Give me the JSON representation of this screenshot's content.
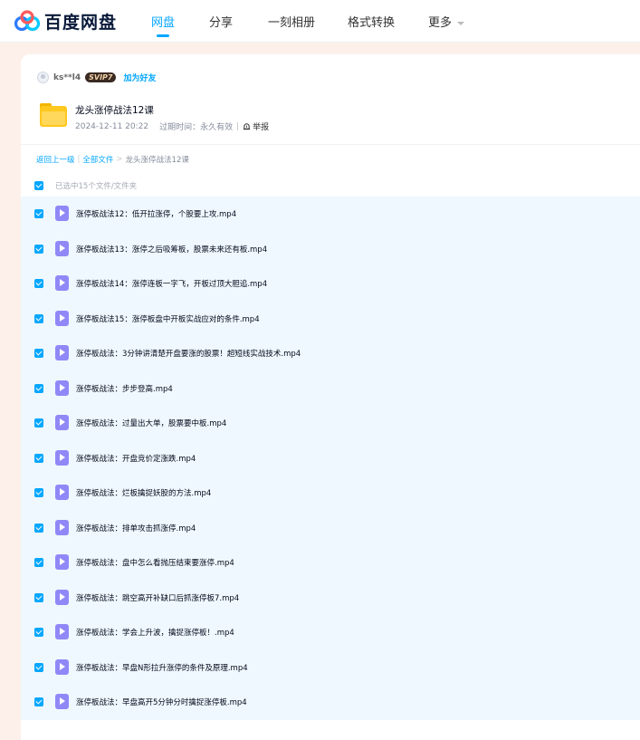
{
  "brand": {
    "name": "百度网盘"
  },
  "nav": {
    "items": [
      {
        "label": "网盘"
      },
      {
        "label": "分享"
      },
      {
        "label": "一刻相册"
      },
      {
        "label": "格式转换"
      },
      {
        "label": "更多"
      }
    ]
  },
  "sharer": {
    "name": "ks**l4",
    "vip": "SVIP7",
    "add_friend": "加为好友"
  },
  "share": {
    "title": "龙头涨停战法12课",
    "date": "2024-12-11 20:22",
    "expiry": "过期时间：永久有效",
    "report": "举报"
  },
  "breadcrumb": {
    "back": "返回上一级",
    "all": "全部文件",
    "current": "龙头涨停战法12课"
  },
  "selection": {
    "text": "已选中15个文件/文件夹"
  },
  "files": [
    {
      "name": "涨停板战法12：低开拉涨停，个股要上攻.mp4"
    },
    {
      "name": "涨停板战法13：涨停之后吸筹板，股票未来还有板.mp4"
    },
    {
      "name": "涨停板战法14：涨停连板一字飞，开板过顶大胆追.mp4"
    },
    {
      "name": "涨停板战法15：涨停板盘中开板实战应对的条件.mp4"
    },
    {
      "name": "涨停板战法：3分钟讲清楚开盘要涨的股票！超短线实战技术.mp4"
    },
    {
      "name": "涨停板战法：步步登高.mp4"
    },
    {
      "name": "涨停板战法：过量出大单，股票要中板.mp4"
    },
    {
      "name": "涨停板战法：开盘竞价定涨跌.mp4"
    },
    {
      "name": "涨停板战法：烂板擒捉妖股的方法.mp4"
    },
    {
      "name": "涨停板战法：排单攻击抓涨停.mp4"
    },
    {
      "name": "涨停板战法：盘中怎么看抛压结束要涨停.mp4"
    },
    {
      "name": "涨停板战法：跳空高开补缺口后抓涨停板7.mp4"
    },
    {
      "name": "涨停板战法：学会上升波，擒捉涨停板！.mp4"
    },
    {
      "name": "涨停板战法：早盘N形拉升涨停的条件及原理.mp4"
    },
    {
      "name": "涨停板战法：早盘高开5分钟分时擒捉涨停板.mp4"
    }
  ],
  "colors": {
    "accent": "#06a7ff",
    "video_icon": "#9088f7",
    "folder": "#ffc81e",
    "list_bg": "#eff8fe"
  }
}
